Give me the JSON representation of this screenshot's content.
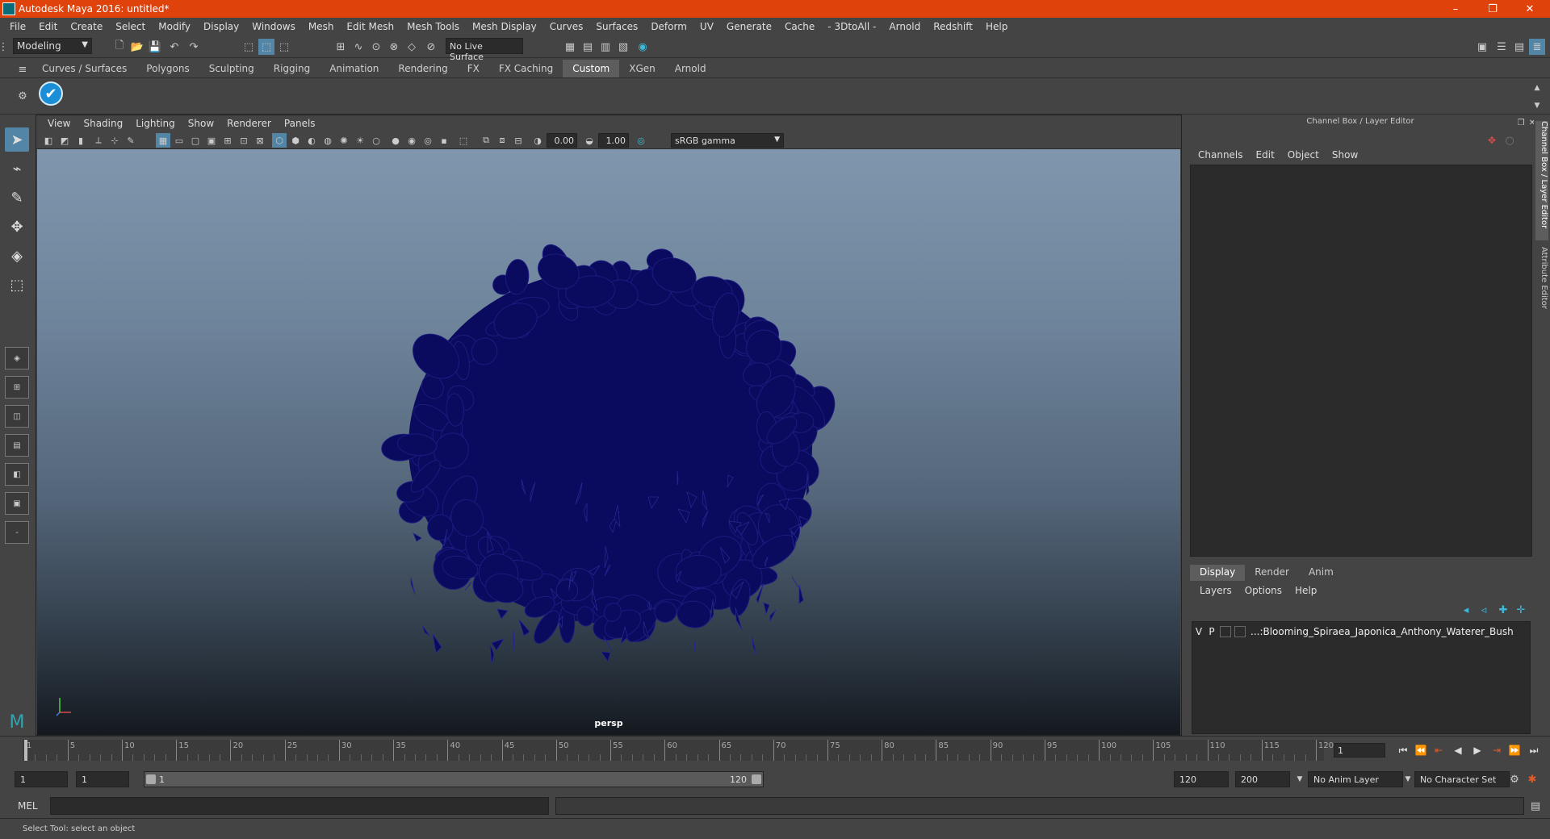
{
  "window": {
    "title": "Autodesk Maya 2016: untitled*",
    "minimize": "–",
    "restore": "❐",
    "close": "✕"
  },
  "menubar": [
    "File",
    "Edit",
    "Create",
    "Select",
    "Modify",
    "Display",
    "Windows",
    "Mesh",
    "Edit Mesh",
    "Mesh Tools",
    "Mesh Display",
    "Curves",
    "Surfaces",
    "Deform",
    "UV",
    "Generate",
    "Cache",
    "- 3DtoAll -",
    "Arnold",
    "Redshift",
    "Help"
  ],
  "statusline": {
    "mode": "Modeling",
    "live_surface": "No Live Surface"
  },
  "shelf": {
    "tabs": [
      "Curves / Surfaces",
      "Polygons",
      "Sculpting",
      "Rigging",
      "Animation",
      "Rendering",
      "FX",
      "FX Caching",
      "Custom",
      "XGen",
      "Arnold"
    ],
    "active": "Custom"
  },
  "viewport": {
    "menu": [
      "View",
      "Shading",
      "Lighting",
      "Show",
      "Renderer",
      "Panels"
    ],
    "exposure": "0.00",
    "gamma": "1.00",
    "color_space": "sRGB gamma",
    "camera": "persp",
    "mesh_color": "#0a0a5e"
  },
  "channel_box": {
    "title": "Channel Box / Layer Editor",
    "menu": [
      "Channels",
      "Edit",
      "Object",
      "Show"
    ],
    "layer_tabs": [
      "Display",
      "Render",
      "Anim"
    ],
    "layer_tab_active": "Display",
    "layer_menu": [
      "Layers",
      "Options",
      "Help"
    ],
    "layers": [
      {
        "v": "V",
        "p": "P",
        "name": "...:Blooming_Spiraea_Japonica_Anthony_Waterer_Bush"
      }
    ]
  },
  "side_tabs": [
    "Channel Box / Layer Editor",
    "Attribute Editor"
  ],
  "timeline": {
    "ticks": [
      "1",
      "5",
      "10",
      "15",
      "20",
      "25",
      "30",
      "35",
      "40",
      "45",
      "50",
      "55",
      "60",
      "65",
      "70",
      "75",
      "80",
      "85",
      "90",
      "95",
      "100",
      "105",
      "110",
      "115",
      "120"
    ],
    "start": 1,
    "end": 120,
    "current_frame": "1"
  },
  "range": {
    "start": "1",
    "anim_start": "1",
    "slider_start": "1",
    "slider_end": "120",
    "anim_end": "120",
    "end": "200",
    "anim_layer": "No Anim Layer",
    "char_set": "No Character Set"
  },
  "command": {
    "label": "MEL"
  },
  "help": {
    "text": "Select Tool: select an object"
  }
}
